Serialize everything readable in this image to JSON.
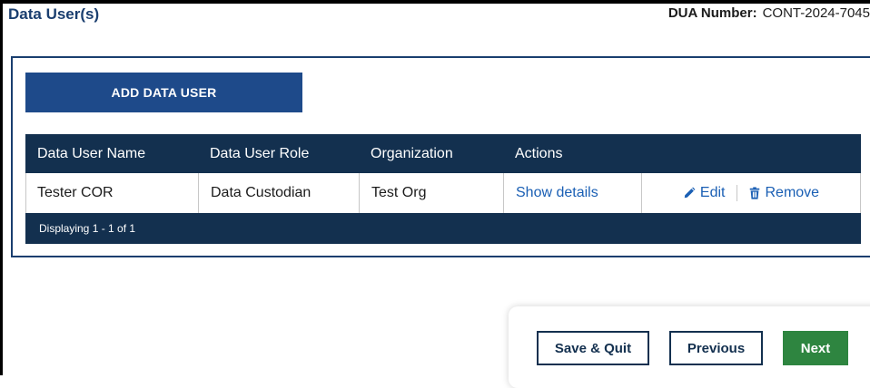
{
  "header": {
    "title": "Data User(s)",
    "dua_label": "DUA Number:",
    "dua_value": "CONT-2024-7045"
  },
  "add_button_label": "ADD DATA USER",
  "table": {
    "columns": [
      "Data User Name",
      "Data User Role",
      "Organization",
      "Actions"
    ],
    "rows": [
      {
        "name": "Tester COR",
        "role": "Data Custodian",
        "organization": "Test Org",
        "details_link": "Show details",
        "edit_label": "Edit",
        "remove_label": "Remove"
      }
    ],
    "footer_text": "Displaying 1 - 1 of 1"
  },
  "footer": {
    "save_quit_label": "Save & Quit",
    "previous_label": "Previous",
    "next_label": "Next"
  },
  "colors": {
    "title": "#1a3e6f",
    "primary_button": "#1e4a8a",
    "table_header": "#13304f",
    "link": "#1a5fb4",
    "next_button": "#2e8540"
  },
  "icons": {
    "edit": "pencil-icon",
    "remove": "trash-icon"
  }
}
